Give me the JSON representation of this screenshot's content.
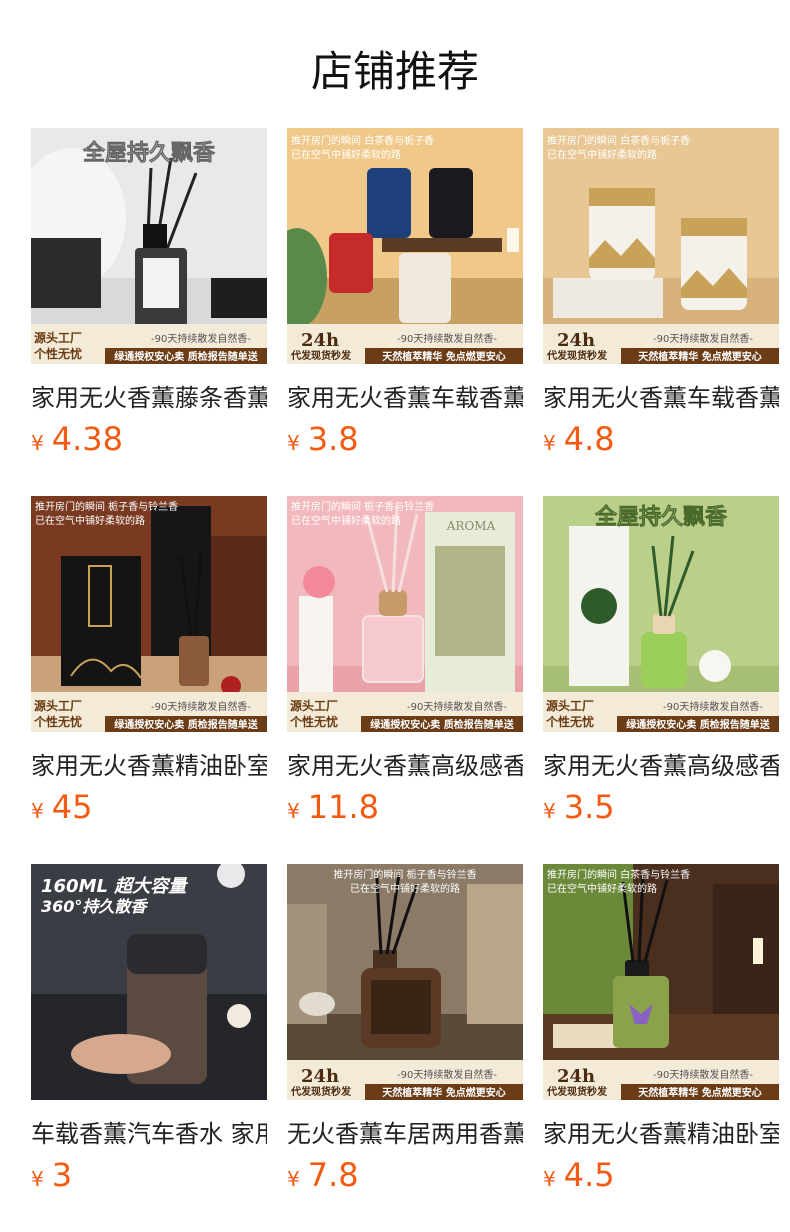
{
  "page": {
    "title": "店铺推荐"
  },
  "colors": {
    "price": "#f35a12"
  },
  "products": [
    {
      "name": "家用无火香薫藤条香薫",
      "currency": "¥",
      "price": "4.38",
      "banner": "全屋持久飘香",
      "factory": "源头工厂",
      "factory2": "个性无忧",
      "slogan": "-90天持续散发自然香-",
      "bar": "绿通授权安心卖 质检报告随单送"
    },
    {
      "name": "家用无火香薫车载香薫",
      "currency": "¥",
      "price": "3.8",
      "banner": "推开房门的瞬间 白茶香与栀子香",
      "banner2": "已在空气中铺好柔软的路",
      "factory": "24h",
      "factory2": "代发现货秒发",
      "slogan": "-90天持续散发自然香-",
      "bar": "天然植萃精华 免点燃更安心"
    },
    {
      "name": "家用无火香薫车载香薫",
      "currency": "¥",
      "price": "4.8",
      "banner": "推开房门的瞬间 白茶香与栀子香",
      "banner2": "已在空气中铺好柔软的路",
      "factory": "24h",
      "factory2": "代发现货秒发",
      "slogan": "-90天持续散发自然香-",
      "bar": "天然植萃精华 免点燃更安心"
    },
    {
      "name": "家用无火香薫精油卧室",
      "currency": "¥",
      "price": "45",
      "banner": "推开房门的瞬间 栀子香与铃兰香",
      "banner2": "已在空气中铺好柔软的路",
      "factory": "源头工厂",
      "factory2": "个性无忧",
      "slogan": "-90天持续散发自然香-",
      "bar": "绿通授权安心卖 质检报告随单送"
    },
    {
      "name": "家用无火香薫高级感香",
      "currency": "¥",
      "price": "11.8",
      "banner": "推开房门的瞬间 栀子香与铃兰香",
      "banner2": "已在空气中铺好柔软的路",
      "factory": "源头工厂",
      "factory2": "个性无忧",
      "slogan": "-90天持续散发自然香-",
      "bar": "绿通授权安心卖 质检报告随单送"
    },
    {
      "name": "家用无火香薫高级感香",
      "currency": "¥",
      "price": "3.5",
      "banner": "全屋持久飘香",
      "factory": "源头工厂",
      "factory2": "个性无忧",
      "slogan": "-90天持续散发自然香-",
      "bar": "绿通授权安心卖 质检报告随单送"
    },
    {
      "name": "车载香薫汽车香水 家用",
      "currency": "¥",
      "price": "3",
      "banner": "160ML 超大容量",
      "banner2": "360°持久散香"
    },
    {
      "name": "无火香薫车居两用香薫",
      "currency": "¥",
      "price": "7.8",
      "banner": "推开房门的瞬间 栀子香与铃兰香",
      "banner2": "已在空气中铺好柔软的路",
      "factory": "24h",
      "factory2": "代发现货秒发",
      "slogan": "-90天持续散发自然香-",
      "bar": "天然植萃精华 免点燃更安心"
    },
    {
      "name": "家用无火香薫精油卧室",
      "currency": "¥",
      "price": "4.5",
      "banner": "推开房门的瞬间 白茶香与铃兰香",
      "banner2": "已在空气中铺好柔软的路",
      "factory": "24h",
      "factory2": "代发现货秒发",
      "slogan": "-90天持续散发自然香-",
      "bar": "天然植萃精华 免点燃更安心"
    }
  ]
}
